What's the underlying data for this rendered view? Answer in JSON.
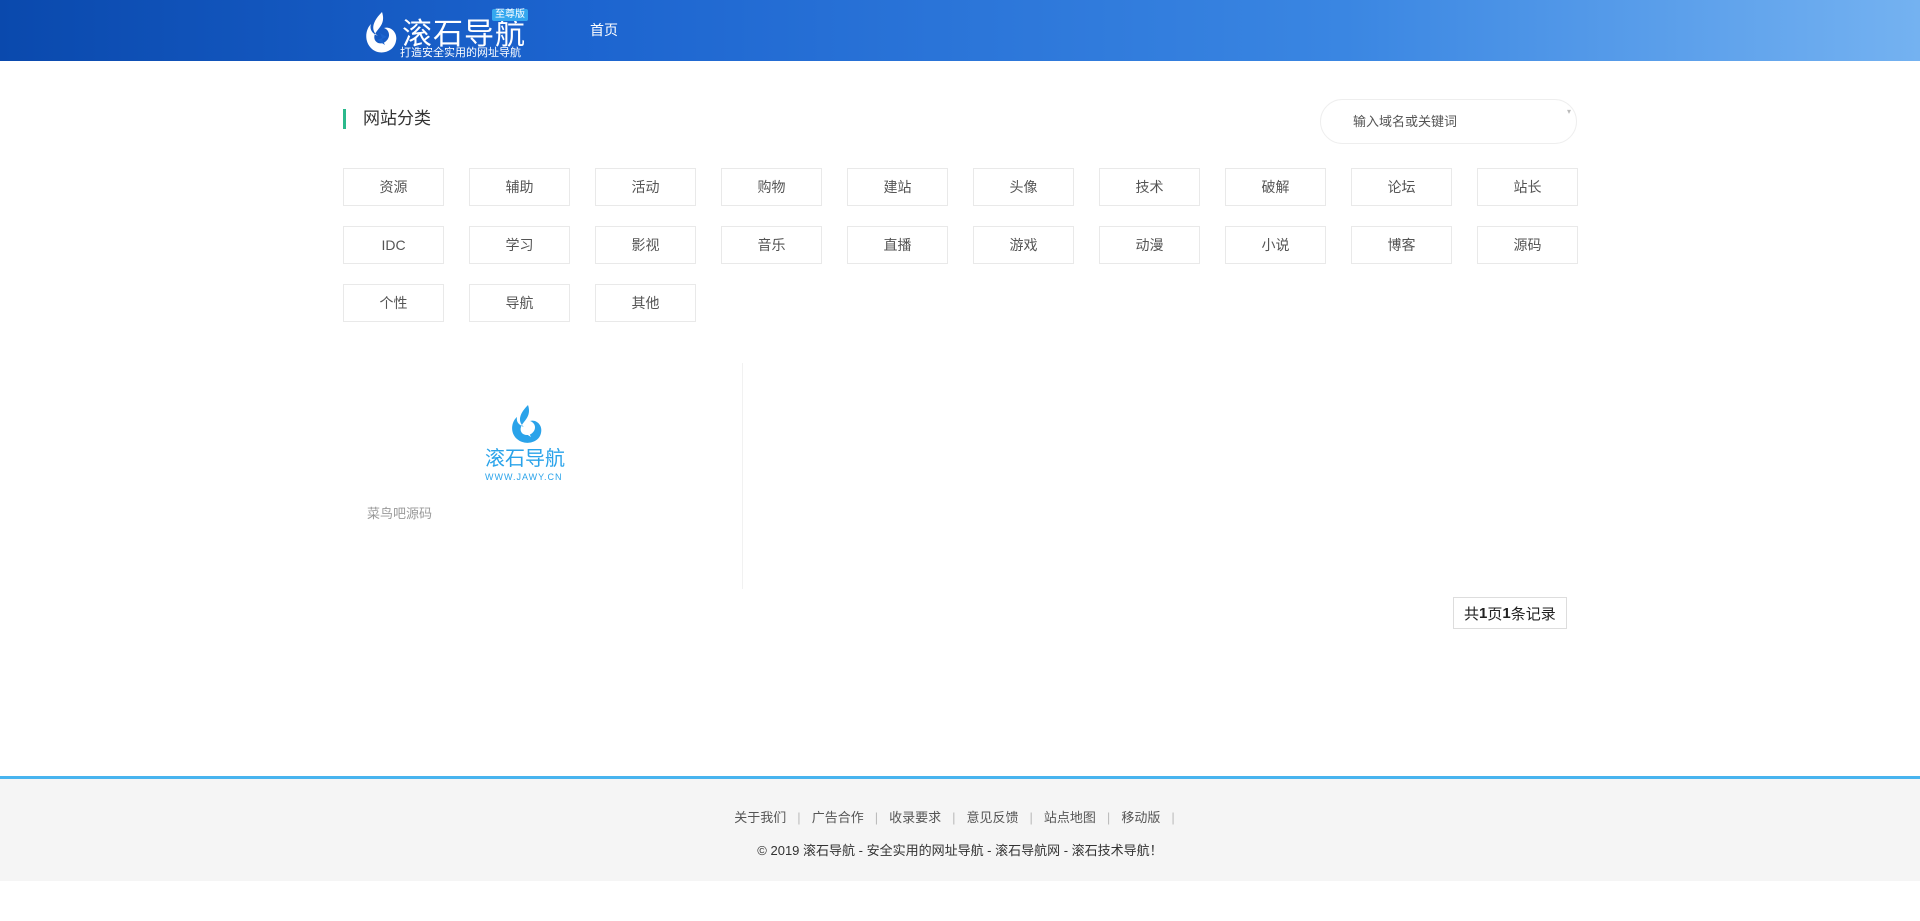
{
  "header": {
    "logo_text": "滚石导航",
    "logo_badge": "至尊版",
    "logo_slogan": "打造安全实用的网址导航",
    "nav": [
      {
        "label": "首页"
      }
    ]
  },
  "section": {
    "title": "网站分类",
    "search_placeholder": "输入域名或关键词"
  },
  "categories": [
    "资源",
    "辅助",
    "活动",
    "购物",
    "建站",
    "头像",
    "技术",
    "破解",
    "论坛",
    "站长",
    "IDC",
    "学习",
    "影视",
    "音乐",
    "直播",
    "游戏",
    "动漫",
    "小说",
    "博客",
    "源码",
    "个性",
    "导航",
    "其他"
  ],
  "site_card": {
    "logo_text": "滚石导航",
    "logo_url": "WWW.JAWY.CN",
    "name": "菜鸟吧源码"
  },
  "pagination": {
    "prefix": "共 ",
    "pages": "1",
    "middle": "页",
    "records": "1",
    "suffix": "条记录"
  },
  "footer": {
    "links": [
      "关于我们",
      "广告合作",
      "收录要求",
      "意见反馈",
      "站点地图",
      "移动版"
    ],
    "copyright": "© 2019 滚石导航 - 安全实用的网址导航 - 滚石导航网 - 滚石技术导航！"
  },
  "colors": {
    "accent": "#2bb98c",
    "header_start": "#0a49ad",
    "header_end": "#74b2f1",
    "footer_border": "#48b4ef",
    "logo_blue": "#2aa3ea"
  }
}
